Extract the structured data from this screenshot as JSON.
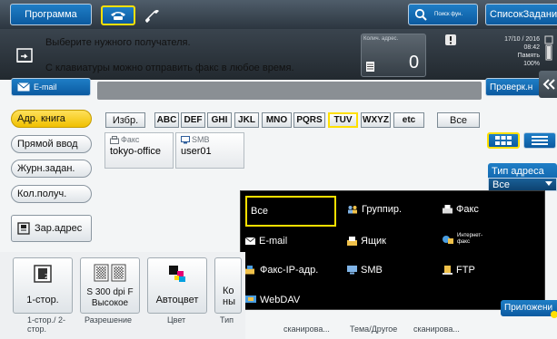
{
  "header": {
    "program_label": "Программа",
    "search_label": "Поиск фун.",
    "job_list_label": "СписокЗаданий"
  },
  "message": {
    "line1": "Выберите нужного получателя.",
    "line2": "С клавиатуры можно отправить факс в любое время.",
    "counter_label": "Колич. адрес.",
    "counter_value": "0",
    "date": "17/10 / 2016",
    "time": "08:42",
    "memory_label": "Память",
    "memory_value": "100%"
  },
  "destination": {
    "email_label": "E-mail",
    "check_label": "Проверк.н",
    "field_value": ""
  },
  "side_menu": {
    "address_book": "Адр. книга",
    "direct_input": "Прямой ввод",
    "job_history": "Журн.задан.",
    "multi_dest": "Кол.получ.",
    "register": "Зар.адрес"
  },
  "index_tabs": [
    "Избр.",
    "ABC",
    "DEF",
    "GHI",
    "JKL",
    "MNO",
    "PQRS",
    "TUV",
    "WXYZ",
    "etc",
    "Все"
  ],
  "entries": [
    {
      "type": "Факс",
      "name": "tokyo-office"
    },
    {
      "type": "SMB",
      "name": "user01"
    }
  ],
  "address_type": {
    "label": "Тип адреса",
    "value": "Все"
  },
  "dropdown": {
    "all": "Все",
    "group": "Группир.",
    "fax": "Факс",
    "email": "E-mail",
    "box": "Ящик",
    "internet_fax": "Интернет- факс",
    "ip_fax": "Факс-IP-адр.",
    "smb": "SMB",
    "ftp": "FTP",
    "webdav": "WebDAV"
  },
  "bottom": {
    "simplex_label": "1-стор.",
    "resolution_label": "S 300 dpi F Высокое",
    "color_label": "Автоцвет",
    "type_partial": "Ко ны",
    "cap_simplex": "1-стор./ 2-стор.",
    "cap_resolution": "Разрешение",
    "cap_color": "Цвет",
    "cap_type": "Тип",
    "cap_scan1": "сканирова...",
    "cap_scan2": "Тема/Другое",
    "cap_scan3": "сканирова...",
    "apps_label": "Приложени"
  },
  "colors": {
    "accent_yellow": "#ffe000",
    "button_blue": "#0b5aa0",
    "header_dark": "#2c3640",
    "dropdown_bg": "#000000"
  }
}
